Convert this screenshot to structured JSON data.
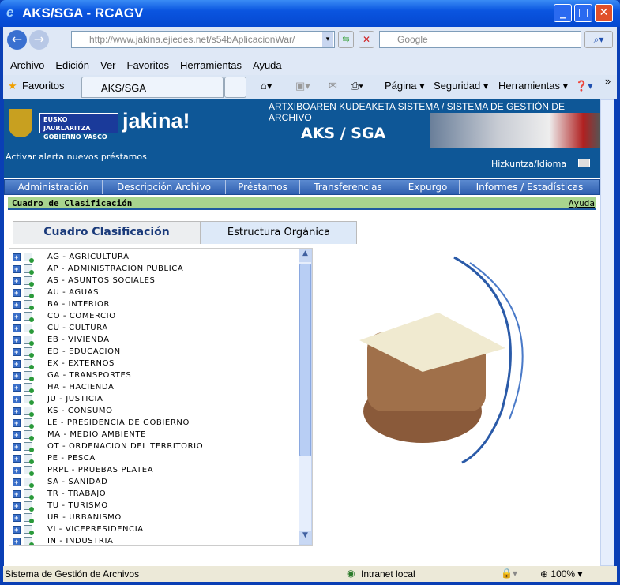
{
  "window": {
    "title": "AKS/SGA - RCAGV"
  },
  "browser": {
    "address": "http://www.jakina.ejiedes.net/s54bAplicacionWar/",
    "search_placeholder": "Google",
    "menu": [
      "Archivo",
      "Edición",
      "Ver",
      "Favoritos",
      "Herramientas",
      "Ayuda"
    ],
    "favorites_label": "Favoritos",
    "tab_label": "AKS/SGA",
    "commands": {
      "page": "Página",
      "security": "Seguridad",
      "tools": "Herramientas"
    }
  },
  "header": {
    "logo_line1": "EUSKO JAURLARITZA",
    "logo_line2": "GOBIERNO VASCO",
    "brand": "jakina!",
    "system_title": "ARTXIBOAREN KUDEAKETA SISTEMA / SISTEMA DE GESTIÓN DE ARCHIVO",
    "app_name": "AKS / SGA",
    "alert_link": "Activar alerta nuevos préstamos",
    "language_link": "Hizkuntza/Idioma"
  },
  "nav": [
    "Administración",
    "Descripción Archivo",
    "Préstamos",
    "Transferencias",
    "Expurgo",
    "Informes / Estadísticas"
  ],
  "section": {
    "title": "Cuadro de Clasificación",
    "help": "Ayuda"
  },
  "tabs": [
    {
      "label": "Cuadro Clasificación",
      "active": true
    },
    {
      "label": "Estructura Orgánica",
      "active": false
    }
  ],
  "tree": [
    "AG - AGRICULTURA",
    "AP - ADMINISTRACION PUBLICA",
    "AS - ASUNTOS SOCIALES",
    "AU - AGUAS",
    "BA - INTERIOR",
    "CO - COMERCIO",
    "CU - CULTURA",
    "EB - VIVIENDA",
    "ED - EDUCACION",
    "EX - EXTERNOS",
    "GA - TRANSPORTES",
    "HA - HACIENDA",
    "JU - JUSTICIA",
    "KS - CONSUMO",
    "LE - PRESIDENCIA DE GOBIERNO",
    "MA - MEDIO AMBIENTE",
    "OT - ORDENACION DEL TERRITORIO",
    "PE - PESCA",
    "PRPL - PRUEBAS PLATEA",
    "SA - SANIDAD",
    "TR - TRABAJO",
    "TU - TURISMO",
    "UR - URBANISMO",
    "VI - VICEPRESIDENCIA",
    "IN - INDUSTRIA"
  ],
  "status": {
    "text": "Sistema de Gestión de Archivos",
    "zone": "Intranet local",
    "zoom": "100%"
  }
}
